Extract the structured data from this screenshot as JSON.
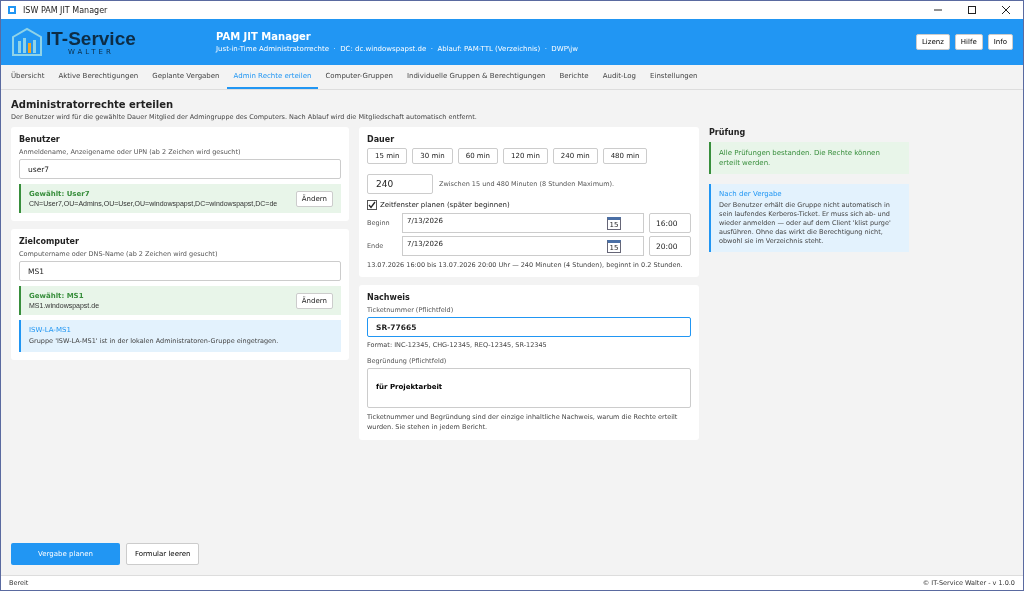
{
  "window": {
    "title": "ISW PAM JIT Manager"
  },
  "header": {
    "logo_text": "IT-Service",
    "logo_subtext": "WALTER",
    "title": "PAM JIT Manager",
    "subtitle": "Just-in-Time Administratorrechte  ·  DC: dc.windowspapst.de  ·  Ablauf: PAM-TTL (Verzeichnis)  ·  DWP\\jw",
    "buttons": [
      "Lizenz",
      "Hilfe",
      "Info"
    ]
  },
  "tabs": [
    {
      "label": "Übersicht",
      "selected": false
    },
    {
      "label": "Aktive Berechtigungen",
      "selected": false
    },
    {
      "label": "Geplante Vergaben",
      "selected": false
    },
    {
      "label": "Admin Rechte erteilen",
      "selected": true
    },
    {
      "label": "Computer-Gruppen",
      "selected": false
    },
    {
      "label": "Individuelle Gruppen & Berechtigungen",
      "selected": false
    },
    {
      "label": "Berichte",
      "selected": false
    },
    {
      "label": "Audit-Log",
      "selected": false
    },
    {
      "label": "Einstellungen",
      "selected": false
    }
  ],
  "page": {
    "title": "Administratorrechte erteilen",
    "description": "Der Benutzer wird für die gewählte Dauer Mitglied der Admingruppe des Computers. Nach Ablauf wird die Mitgliedschaft automatisch entfernt."
  },
  "user": {
    "title": "Benutzer",
    "label": "Anmeldename, Anzeigename oder UPN (ab 2 Zeichen wird gesucht)",
    "value": "user7",
    "selected_label": "Gewählt:  User7",
    "selected_detail": "CN=User7,OU=Admins,OU=User,OU=windowspapst,DC=windowspapst,DC=de",
    "change_button": "Ändern"
  },
  "computer": {
    "title": "Zielcomputer",
    "label": "Computername oder DNS-Name (ab 2 Zeichen wird gesucht)",
    "value": "MS1",
    "selected_label": "Gewählt:  MS1",
    "selected_detail": "MS1.windowspapst.de",
    "change_button": "Ändern",
    "group_title": "ISW-LA-MS1",
    "group_text": "Gruppe 'ISW-LA-MS1' ist in der lokalen Administratoren-Gruppe eingetragen."
  },
  "duration": {
    "title": "Dauer",
    "presets": [
      "15  min",
      "30  min",
      "60  min",
      "120  min",
      "240  min",
      "480  min"
    ],
    "minutes": "240",
    "hint": "Zwischen 15 und 480 Minuten (8 Stunden Maximum).",
    "schedule_label": "Zeitfenster planen (später beginnen)",
    "schedule_checked": true,
    "rows": [
      {
        "label": "Beginn",
        "date": "7/13/2026",
        "calendar_day": "15",
        "time": "16:00"
      },
      {
        "label": "Ende",
        "date": "7/13/2026",
        "calendar_day": "15",
        "time": "20:00"
      }
    ],
    "summary": "13.07.2026 16:00 bis 13.07.2026 20:00 Uhr — 240 Minuten (4 Stunden), beginnt in 0.2 Stunden."
  },
  "evidence": {
    "title": "Nachweis",
    "ticket_label": "Ticketnummer (Pflichtfeld)",
    "ticket_value": "SR-77665",
    "ticket_hint": "Format: INC-12345, CHG-12345, REQ-12345, SR-12345",
    "reason_label": "Begründung (Pflichtfeld)",
    "reason_value": "für Projektarbeit",
    "note": "Ticketnummer und Begründung sind der einzige inhaltliche Nachweis, warum die Rechte erteilt wurden. Sie stehen in jedem Bericht."
  },
  "check": {
    "title": "Prüfung",
    "result": "Alle Prüfungen bestanden. Die Rechte können erteilt werden.",
    "info_title": "Nach der Vergabe",
    "info_text": "Der Benutzer erhält die Gruppe nicht automatisch in sein laufendes Kerberos-Ticket. Er muss sich ab- und wieder anmelden — oder auf dem Client 'klist purge' ausführen. Ohne das wirkt die Berechtigung nicht, obwohl sie im Verzeichnis steht."
  },
  "actions": [
    {
      "label": "Vergabe planen",
      "kind": "primary"
    },
    {
      "label": "Formular leeren",
      "kind": "secondary"
    }
  ],
  "status_bar": {
    "left": "Bereit",
    "right": "© IT-Service Walter  - v 1.0.0"
  }
}
